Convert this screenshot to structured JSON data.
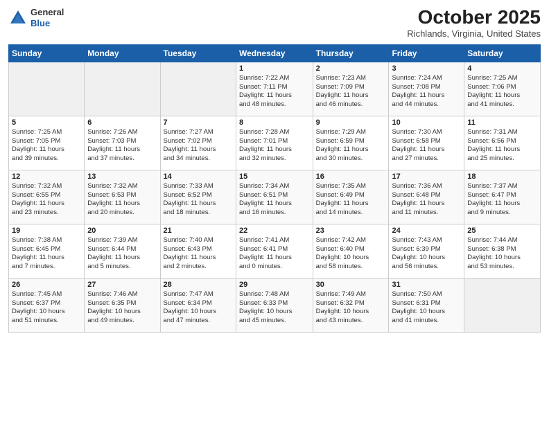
{
  "header": {
    "logo": {
      "general": "General",
      "blue": "Blue"
    },
    "title": "October 2025",
    "location": "Richlands, Virginia, United States"
  },
  "days_of_week": [
    "Sunday",
    "Monday",
    "Tuesday",
    "Wednesday",
    "Thursday",
    "Friday",
    "Saturday"
  ],
  "weeks": [
    [
      {
        "num": "",
        "info": ""
      },
      {
        "num": "",
        "info": ""
      },
      {
        "num": "",
        "info": ""
      },
      {
        "num": "1",
        "info": "Sunrise: 7:22 AM\nSunset: 7:11 PM\nDaylight: 11 hours\nand 48 minutes."
      },
      {
        "num": "2",
        "info": "Sunrise: 7:23 AM\nSunset: 7:09 PM\nDaylight: 11 hours\nand 46 minutes."
      },
      {
        "num": "3",
        "info": "Sunrise: 7:24 AM\nSunset: 7:08 PM\nDaylight: 11 hours\nand 44 minutes."
      },
      {
        "num": "4",
        "info": "Sunrise: 7:25 AM\nSunset: 7:06 PM\nDaylight: 11 hours\nand 41 minutes."
      }
    ],
    [
      {
        "num": "5",
        "info": "Sunrise: 7:25 AM\nSunset: 7:05 PM\nDaylight: 11 hours\nand 39 minutes."
      },
      {
        "num": "6",
        "info": "Sunrise: 7:26 AM\nSunset: 7:03 PM\nDaylight: 11 hours\nand 37 minutes."
      },
      {
        "num": "7",
        "info": "Sunrise: 7:27 AM\nSunset: 7:02 PM\nDaylight: 11 hours\nand 34 minutes."
      },
      {
        "num": "8",
        "info": "Sunrise: 7:28 AM\nSunset: 7:01 PM\nDaylight: 11 hours\nand 32 minutes."
      },
      {
        "num": "9",
        "info": "Sunrise: 7:29 AM\nSunset: 6:59 PM\nDaylight: 11 hours\nand 30 minutes."
      },
      {
        "num": "10",
        "info": "Sunrise: 7:30 AM\nSunset: 6:58 PM\nDaylight: 11 hours\nand 27 minutes."
      },
      {
        "num": "11",
        "info": "Sunrise: 7:31 AM\nSunset: 6:56 PM\nDaylight: 11 hours\nand 25 minutes."
      }
    ],
    [
      {
        "num": "12",
        "info": "Sunrise: 7:32 AM\nSunset: 6:55 PM\nDaylight: 11 hours\nand 23 minutes."
      },
      {
        "num": "13",
        "info": "Sunrise: 7:32 AM\nSunset: 6:53 PM\nDaylight: 11 hours\nand 20 minutes."
      },
      {
        "num": "14",
        "info": "Sunrise: 7:33 AM\nSunset: 6:52 PM\nDaylight: 11 hours\nand 18 minutes."
      },
      {
        "num": "15",
        "info": "Sunrise: 7:34 AM\nSunset: 6:51 PM\nDaylight: 11 hours\nand 16 minutes."
      },
      {
        "num": "16",
        "info": "Sunrise: 7:35 AM\nSunset: 6:49 PM\nDaylight: 11 hours\nand 14 minutes."
      },
      {
        "num": "17",
        "info": "Sunrise: 7:36 AM\nSunset: 6:48 PM\nDaylight: 11 hours\nand 11 minutes."
      },
      {
        "num": "18",
        "info": "Sunrise: 7:37 AM\nSunset: 6:47 PM\nDaylight: 11 hours\nand 9 minutes."
      }
    ],
    [
      {
        "num": "19",
        "info": "Sunrise: 7:38 AM\nSunset: 6:45 PM\nDaylight: 11 hours\nand 7 minutes."
      },
      {
        "num": "20",
        "info": "Sunrise: 7:39 AM\nSunset: 6:44 PM\nDaylight: 11 hours\nand 5 minutes."
      },
      {
        "num": "21",
        "info": "Sunrise: 7:40 AM\nSunset: 6:43 PM\nDaylight: 11 hours\nand 2 minutes."
      },
      {
        "num": "22",
        "info": "Sunrise: 7:41 AM\nSunset: 6:41 PM\nDaylight: 11 hours\nand 0 minutes."
      },
      {
        "num": "23",
        "info": "Sunrise: 7:42 AM\nSunset: 6:40 PM\nDaylight: 10 hours\nand 58 minutes."
      },
      {
        "num": "24",
        "info": "Sunrise: 7:43 AM\nSunset: 6:39 PM\nDaylight: 10 hours\nand 56 minutes."
      },
      {
        "num": "25",
        "info": "Sunrise: 7:44 AM\nSunset: 6:38 PM\nDaylight: 10 hours\nand 53 minutes."
      }
    ],
    [
      {
        "num": "26",
        "info": "Sunrise: 7:45 AM\nSunset: 6:37 PM\nDaylight: 10 hours\nand 51 minutes."
      },
      {
        "num": "27",
        "info": "Sunrise: 7:46 AM\nSunset: 6:35 PM\nDaylight: 10 hours\nand 49 minutes."
      },
      {
        "num": "28",
        "info": "Sunrise: 7:47 AM\nSunset: 6:34 PM\nDaylight: 10 hours\nand 47 minutes."
      },
      {
        "num": "29",
        "info": "Sunrise: 7:48 AM\nSunset: 6:33 PM\nDaylight: 10 hours\nand 45 minutes."
      },
      {
        "num": "30",
        "info": "Sunrise: 7:49 AM\nSunset: 6:32 PM\nDaylight: 10 hours\nand 43 minutes."
      },
      {
        "num": "31",
        "info": "Sunrise: 7:50 AM\nSunset: 6:31 PM\nDaylight: 10 hours\nand 41 minutes."
      },
      {
        "num": "",
        "info": ""
      }
    ]
  ]
}
